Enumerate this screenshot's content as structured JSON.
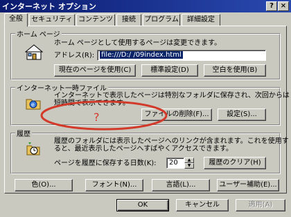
{
  "window": {
    "title": "インターネット オプション",
    "help_button": "?",
    "close_button": "×"
  },
  "tabs": [
    "全般",
    "セキュリティ",
    "コンテンツ",
    "接続",
    "プログラム",
    "詳細設定"
  ],
  "home_page": {
    "legend": "ホーム ページ",
    "description": "ホーム ページとして使用するページは変更できます。",
    "address_label": "アドレス(R):",
    "address_value": "file:///D:/         /09index.html",
    "use_current_button": "現在のページを使用(C)",
    "use_default_button": "標準設定(D)",
    "use_blank_button": "空白を使用(B)"
  },
  "temp_files": {
    "legend": "インターネット一時ファイル",
    "description_line1": "インターネットで表示したページは特別なフォルダに保存され、次回からは",
    "description_line2": "短時間で表示できます。",
    "delete_files_button": "ファイルの削除(F)...",
    "settings_button": "設定(S)..."
  },
  "annotation": {
    "mark": "?",
    "color": "#d23a2a"
  },
  "history": {
    "legend": "履歴",
    "description_line1": "履歴のフォルダには表示したページへのリンクが含まれます。これを使用す",
    "description_line2": "ると、最近表示したページへすばやくアクセスできます。",
    "days_label": "ページを履歴に保存する日数(K):",
    "days_value": "20",
    "clear_history_button": "履歴のクリア(H)"
  },
  "bottom_buttons": {
    "colors": "色(O)...",
    "fonts": "フォント(N)...",
    "languages": "言語(L)...",
    "accessibility": "ユーザー補助(E)..."
  },
  "dialog_buttons": {
    "ok": "OK",
    "cancel": "キャンセル",
    "apply": "適用(A)"
  },
  "colors": {
    "titlebar": "#0a1a6e",
    "face": "#c9c9c0"
  }
}
